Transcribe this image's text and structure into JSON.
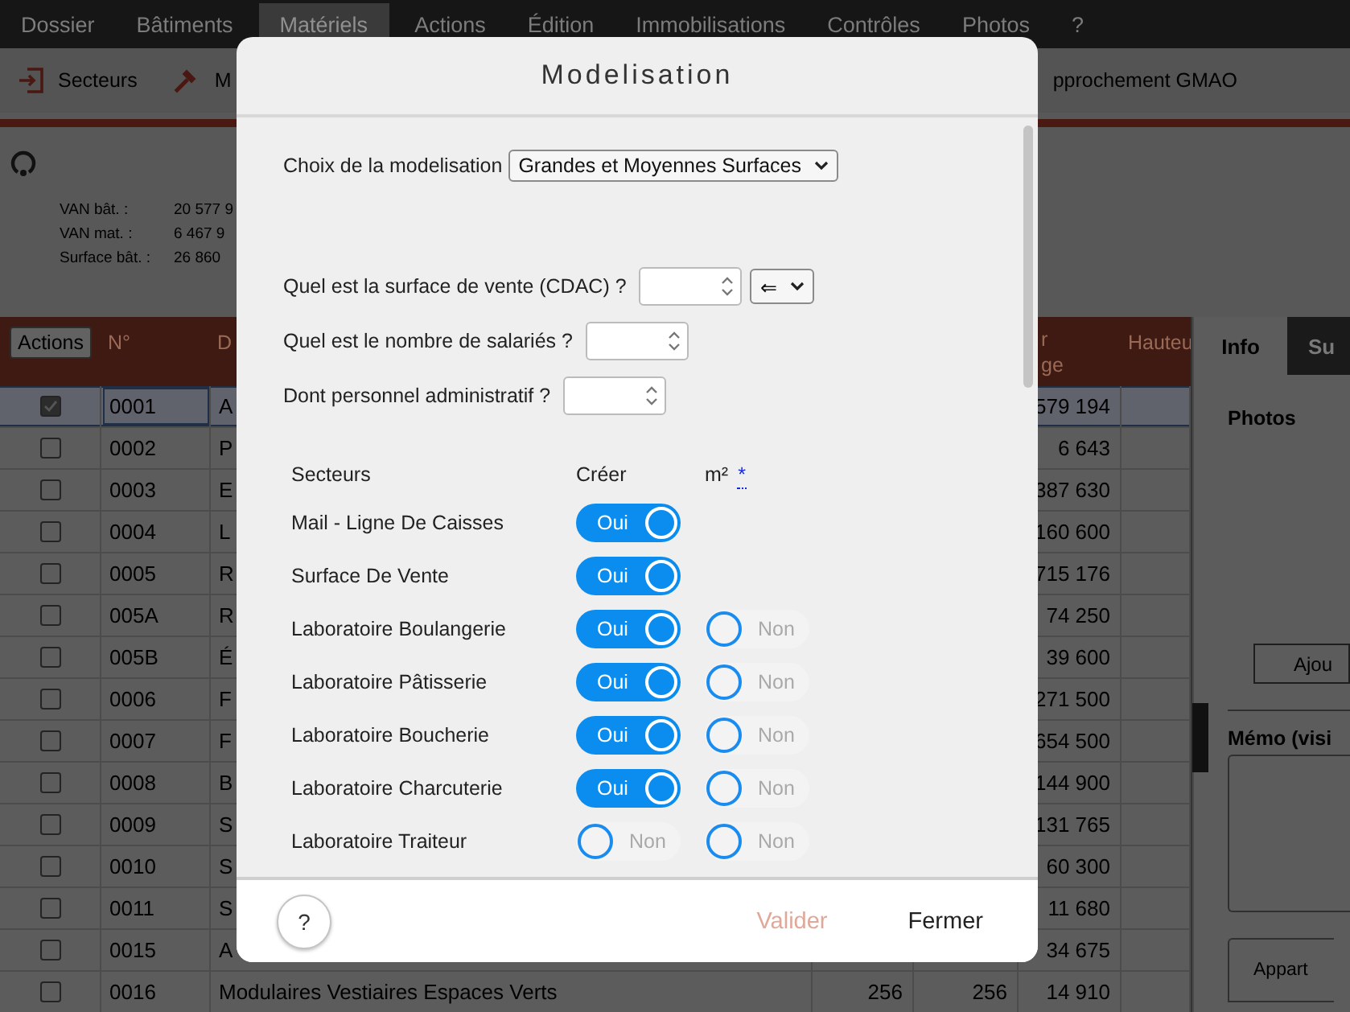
{
  "menu": [
    {
      "label": "Dossier",
      "selected": false
    },
    {
      "label": "Bâtiments",
      "selected": false
    },
    {
      "label": "Matériels",
      "selected": true
    },
    {
      "label": "Actions",
      "selected": false
    },
    {
      "label": "Édition",
      "selected": false
    },
    {
      "label": "Immobilisations",
      "selected": false
    },
    {
      "label": "Contrôles",
      "selected": false
    },
    {
      "label": "Photos",
      "selected": false
    },
    {
      "label": "?",
      "selected": false
    }
  ],
  "toolbar": [
    {
      "label": "Secteurs",
      "kind": "enter"
    },
    {
      "label": "M",
      "kind": "hammer"
    },
    {
      "label": "pprochement GMAO",
      "kind": "none"
    }
  ],
  "summary": [
    {
      "label": "VAN bât. :",
      "value": "20 577 9"
    },
    {
      "label": "VAN mat. :",
      "value": "6 467 9"
    },
    {
      "label": "Surface bât. :",
      "value": "26 860"
    }
  ],
  "table": {
    "actions_button": "Actions",
    "columns": [
      "N°",
      "D",
      "r\nge",
      "Hauteu"
    ],
    "rows": [
      {
        "checked": true,
        "selected": true,
        "number": "0001",
        "description": "A",
        "value": "579 194"
      },
      {
        "checked": false,
        "selected": false,
        "number": "0002",
        "description": "P",
        "value": "6 643"
      },
      {
        "checked": false,
        "selected": false,
        "number": "0003",
        "description": "E",
        "value": "387 630"
      },
      {
        "checked": false,
        "selected": false,
        "number": "0004",
        "description": "L",
        "value": "160 600"
      },
      {
        "checked": false,
        "selected": false,
        "number": "0005",
        "description": "R",
        "value": "715 176"
      },
      {
        "checked": false,
        "selected": false,
        "number": "005A",
        "description": "R",
        "value": "74 250"
      },
      {
        "checked": false,
        "selected": false,
        "number": "005B",
        "description": "É",
        "value": "39 600"
      },
      {
        "checked": false,
        "selected": false,
        "number": "0006",
        "description": "F",
        "value": "271 500"
      },
      {
        "checked": false,
        "selected": false,
        "number": "0007",
        "description": "F",
        "value": "654 500"
      },
      {
        "checked": false,
        "selected": false,
        "number": "0008",
        "description": "B",
        "value": "144 900"
      },
      {
        "checked": false,
        "selected": false,
        "number": "0009",
        "description": "S",
        "value": "131 765"
      },
      {
        "checked": false,
        "selected": false,
        "number": "0010",
        "description": "S",
        "value": "60 300"
      },
      {
        "checked": false,
        "selected": false,
        "number": "0011",
        "description": "S",
        "value": "11 680"
      },
      {
        "checked": false,
        "selected": false,
        "number": "0015",
        "description": "A",
        "value": "34 675"
      },
      {
        "checked": false,
        "selected": false,
        "number": "0016",
        "description": "Modulaires Vestiaires Espaces Verts",
        "column_5": "256",
        "column_6": "256",
        "value": "14 910"
      }
    ]
  },
  "side_panel": {
    "tabs": [
      {
        "label": "Info",
        "selected": true
      },
      {
        "label": "Su",
        "selected": false
      }
    ],
    "photos_heading": "Photos",
    "add_button": "Ajou",
    "memo_label": "Mémo (visi",
    "bottom_button": "Appart"
  },
  "modal": {
    "title": "Modelisation",
    "choice_label": "Choix de la modelisation",
    "choice_value": "Grandes et Moyennes Surfaces",
    "questions": [
      {
        "label": "Quel est la surface de vente (CDAC) ?",
        "unit": "⇐"
      },
      {
        "label": "Quel est le nombre de salariés ?"
      },
      {
        "label": "Dont personnel administratif ?"
      }
    ],
    "sectors_header": {
      "name": "Secteurs",
      "create": "Créer",
      "area": "m²",
      "area_link": "*"
    },
    "sectors": [
      {
        "name": "Mail - Ligne De Caisses",
        "create": {
          "on": true,
          "label": "Oui"
        }
      },
      {
        "name": "Surface De Vente",
        "create": {
          "on": true,
          "label": "Oui"
        }
      },
      {
        "name": "Laboratoire Boulangerie",
        "create": {
          "on": true,
          "label": "Oui"
        },
        "area": {
          "on": false,
          "label": "Non"
        }
      },
      {
        "name": "Laboratoire Pâtisserie",
        "create": {
          "on": true,
          "label": "Oui"
        },
        "area": {
          "on": false,
          "label": "Non"
        }
      },
      {
        "name": "Laboratoire Boucherie",
        "create": {
          "on": true,
          "label": "Oui"
        },
        "area": {
          "on": false,
          "label": "Non"
        }
      },
      {
        "name": "Laboratoire Charcuterie",
        "create": {
          "on": true,
          "label": "Oui"
        },
        "area": {
          "on": false,
          "label": "Non"
        }
      },
      {
        "name": "Laboratoire Traiteur",
        "create": {
          "on": false,
          "label": "Non"
        },
        "area": {
          "on": false,
          "label": "Non"
        }
      }
    ],
    "help_button": "?",
    "validate_button": {
      "label": "Valider",
      "disabled": true
    },
    "close_button": "Fermer"
  }
}
